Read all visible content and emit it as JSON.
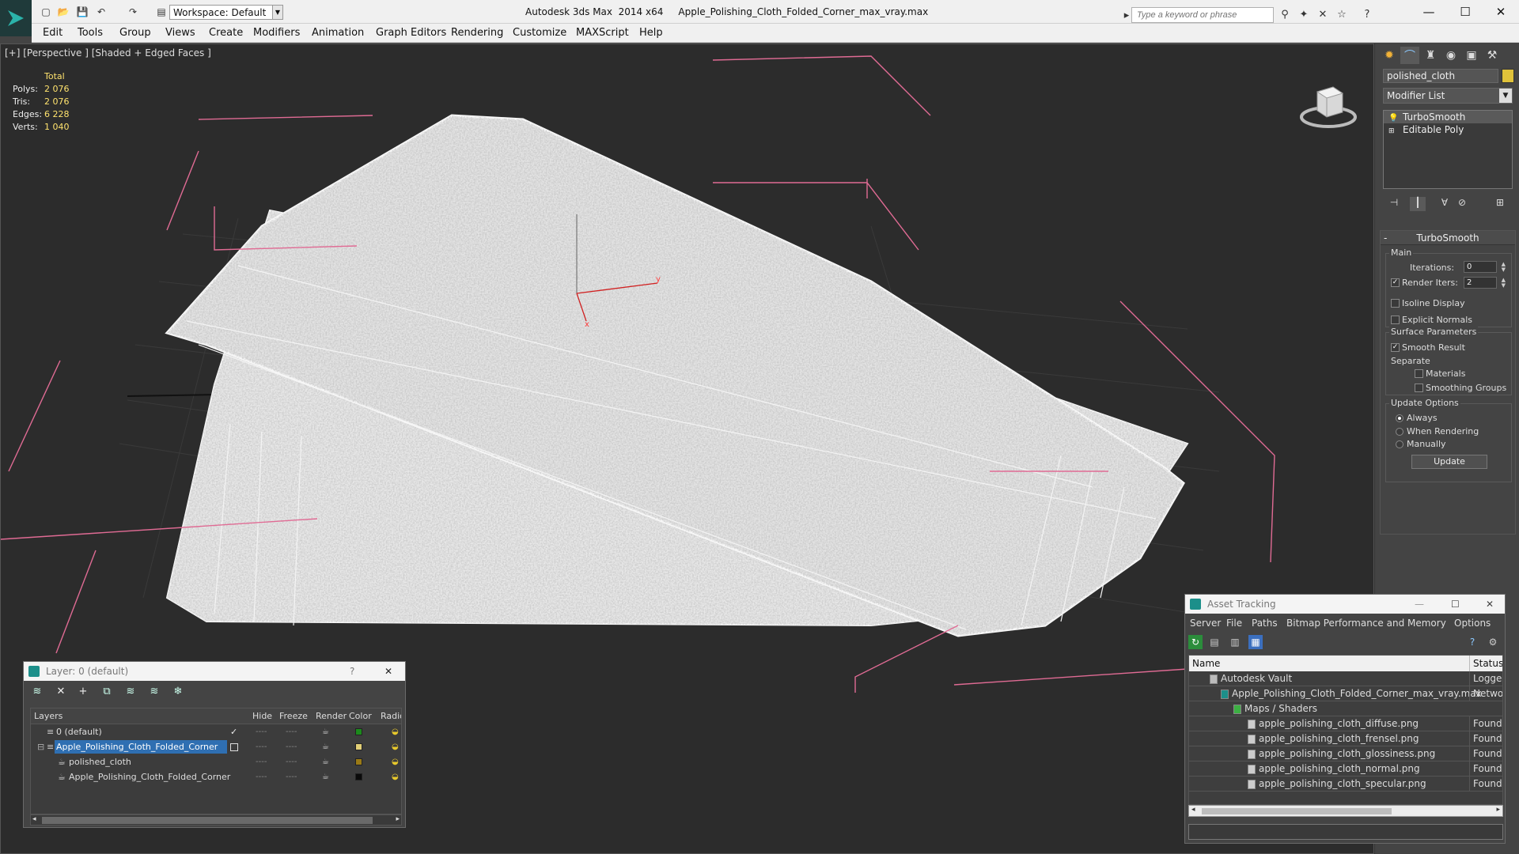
{
  "app": {
    "title": "Autodesk 3ds Max  2014 x64     Apple_Polishing_Cloth_Folded_Corner_max_vray.max",
    "workspace": "Workspace: Default",
    "search_placeholder": "Type a keyword or phrase"
  },
  "menu": [
    "Edit",
    "Tools",
    "Group",
    "Views",
    "Create",
    "Modifiers",
    "Animation",
    "Graph Editors",
    "Rendering",
    "Customize",
    "MAXScript",
    "Help"
  ],
  "viewport": {
    "label": "[+] [Perspective ] [Shaded + Edged Faces ]",
    "stats": {
      "header": "Total",
      "rows": [
        {
          "k": "Polys:",
          "v": "2 076"
        },
        {
          "k": "Tris:",
          "v": "2 076"
        },
        {
          "k": "Edges:",
          "v": "6 228"
        },
        {
          "k": "Verts:",
          "v": "1 040"
        }
      ]
    },
    "axis_x": "x",
    "axis_y": "y"
  },
  "command_panel": {
    "object_name": "polished_cloth",
    "object_color": "#e0c23a",
    "modifier_list": "Modifier List",
    "stack": [
      "TurboSmooth",
      "Editable Poly"
    ],
    "turbosmooth": {
      "title": "TurboSmooth",
      "main": "Main",
      "iterations_label": "Iterations:",
      "iterations_value": "0",
      "render_iters_label": "Render Iters:",
      "render_iters_value": "2",
      "isoline": "Isoline Display",
      "explicit_normals": "Explicit Normals",
      "surface_params": "Surface Parameters",
      "smooth_result": "Smooth Result",
      "separate": "Separate",
      "materials": "Materials",
      "smoothing_groups": "Smoothing Groups",
      "update_options": "Update Options",
      "always": "Always",
      "when_rendering": "When Rendering",
      "manually": "Manually",
      "update_button": "Update"
    }
  },
  "layer_dialog": {
    "title": "Layer: 0 (default)",
    "help": "?",
    "columns": [
      "Layers",
      "Hide",
      "Freeze",
      "Render",
      "Color",
      "Radio"
    ],
    "rows": [
      {
        "name": "0 (default)",
        "color": "#1c8a1c"
      },
      {
        "name": "Apple_Polishing_Cloth_Folded_Corner",
        "color": "#e2cf76"
      },
      {
        "name": "polished_cloth",
        "color": "#9a7a16"
      },
      {
        "name": "Apple_Polishing_Cloth_Folded_Corner",
        "color": "#0a0a0a"
      }
    ]
  },
  "asset_dialog": {
    "title": "Asset Tracking",
    "menu": [
      "Server",
      "File",
      "Paths",
      "Bitmap Performance and Memory",
      "Options"
    ],
    "col_name": "Name",
    "col_status": "Status",
    "rows": [
      {
        "name": "Autodesk Vault",
        "status": "Logged"
      },
      {
        "name": "Apple_Polishing_Cloth_Folded_Corner_max_vray.max",
        "status": "Network"
      },
      {
        "name": "Maps / Shaders",
        "status": ""
      },
      {
        "name": "apple_polishing_cloth_diffuse.png",
        "status": "Found"
      },
      {
        "name": "apple_polishing_cloth_frensel.png",
        "status": "Found"
      },
      {
        "name": "apple_polishing_cloth_glossiness.png",
        "status": "Found"
      },
      {
        "name": "apple_polishing_cloth_normal.png",
        "status": "Found"
      },
      {
        "name": "apple_polishing_cloth_specular.png",
        "status": "Found"
      }
    ]
  }
}
